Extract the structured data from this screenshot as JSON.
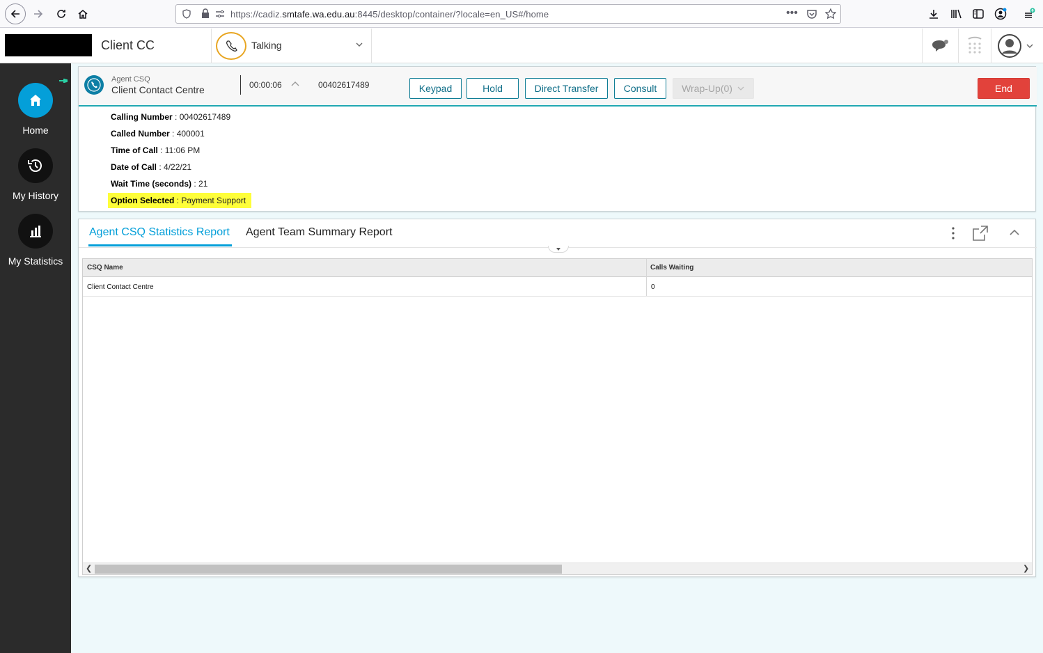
{
  "browser": {
    "url_prefix": "https://cadiz.",
    "url_domain": "smtafe.wa.edu.au",
    "url_suffix": ":8445/desktop/container/?locale=en_US#/home"
  },
  "header": {
    "team_name": "Client CC",
    "agent_state": "Talking"
  },
  "sidebar": {
    "items": [
      {
        "label": "Home",
        "icon": "home-icon"
      },
      {
        "label": "My History",
        "icon": "history-icon"
      },
      {
        "label": "My Statistics",
        "icon": "bar-chart-icon"
      }
    ]
  },
  "call": {
    "csq_caption": "Agent CSQ",
    "csq_name": "Client Contact Centre",
    "timer": "00:00:06",
    "ani": "00402617489",
    "buttons": {
      "keypad": "Keypad",
      "hold": "Hold",
      "direct_transfer": "Direct Transfer",
      "consult": "Consult",
      "wrapup": "Wrap-Up(0)",
      "end": "End"
    },
    "details": [
      {
        "label": "Calling Number",
        "value": ": 00402617489"
      },
      {
        "label": "Called Number",
        "value": ": 400001"
      },
      {
        "label": "Time of Call",
        "value": ": 11:06 PM"
      },
      {
        "label": "Date of Call",
        "value": ": 4/22/21"
      },
      {
        "label": "Wait Time (seconds)",
        "value": ": 21"
      },
      {
        "label": "Option Selected",
        "value": ": Payment Support"
      }
    ]
  },
  "reports": {
    "tabs": [
      "Agent CSQ Statistics Report",
      "Agent Team Summary Report"
    ],
    "columns": [
      "CSQ Name",
      "Calls Waiting"
    ],
    "rows": [
      {
        "csq_name": "Client Contact Centre",
        "calls_waiting": "0"
      }
    ]
  },
  "colors": {
    "accent": "#049fd9",
    "talking_ring": "#e8a623",
    "end_button": "#e2423b",
    "highlight": "#fefe3a",
    "sidebar": "#2b2b2b"
  }
}
